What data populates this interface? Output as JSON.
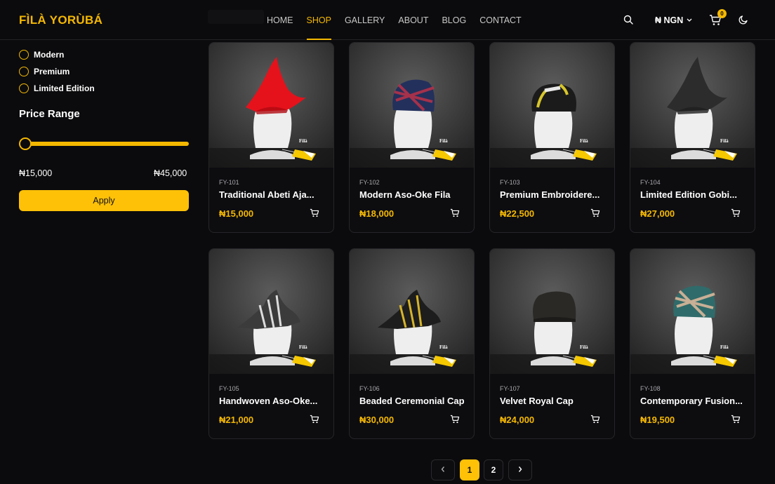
{
  "brand": {
    "logo": "FÌLÀ YORÙBÁ"
  },
  "nav": [
    "HOME",
    "SHOP",
    "GALLERY",
    "ABOUT",
    "BLOG",
    "CONTACT"
  ],
  "nav_active": "SHOP",
  "header": {
    "currency": "₦ NGN",
    "cart_count": "0"
  },
  "filters": {
    "styles": [
      "Modern",
      "Premium",
      "Limited Edition"
    ],
    "price_title": "Price Range",
    "price_min": "₦15,000",
    "price_max": "₦45,000",
    "apply_label": "Apply"
  },
  "products": [
    {
      "sku": "FY-101",
      "name": "Traditional Abeti Aja...",
      "price": "₦15,000",
      "hat": "abeti",
      "color": "#e5121c",
      "accent": "#b00a12"
    },
    {
      "sku": "FY-102",
      "name": "Modern Aso-Oke Fila",
      "price": "₦18,000",
      "hat": "wrap",
      "color": "#23305c",
      "accent": "#b4324a"
    },
    {
      "sku": "FY-103",
      "name": "Premium Embroidere...",
      "price": "₦22,500",
      "hat": "round",
      "color": "#1b1b1b",
      "accent": "#d8c62a"
    },
    {
      "sku": "FY-104",
      "name": "Limited Edition Gobi...",
      "price": "₦27,000",
      "hat": "abeti",
      "color": "#2c2c2c",
      "accent": "#1f1f1f"
    },
    {
      "sku": "FY-105",
      "name": "Handwoven Aso-Oke...",
      "price": "₦21,000",
      "hat": "abeti-low",
      "color": "#3b3b3b",
      "accent": "#dcdcdc"
    },
    {
      "sku": "FY-106",
      "name": "Beaded Ceremonial Cap",
      "price": "₦30,000",
      "hat": "abeti-low",
      "color": "#1d1d1d",
      "accent": "#d6b42a"
    },
    {
      "sku": "FY-107",
      "name": "Velvet Royal Cap",
      "price": "₦24,000",
      "hat": "cap",
      "color": "#2a2926",
      "accent": "#1c1b19"
    },
    {
      "sku": "FY-108",
      "name": "Contemporary Fusion...",
      "price": "₦19,500",
      "hat": "wrap",
      "color": "#2f6b6a",
      "accent": "#d9b79a"
    }
  ],
  "card_watermark": "Fìlà",
  "pagination": {
    "pages": [
      "1",
      "2"
    ],
    "current": "1"
  },
  "colors": {
    "accent": "#f5b800",
    "background": "#0b0b0d",
    "card": "#0d0d10"
  }
}
